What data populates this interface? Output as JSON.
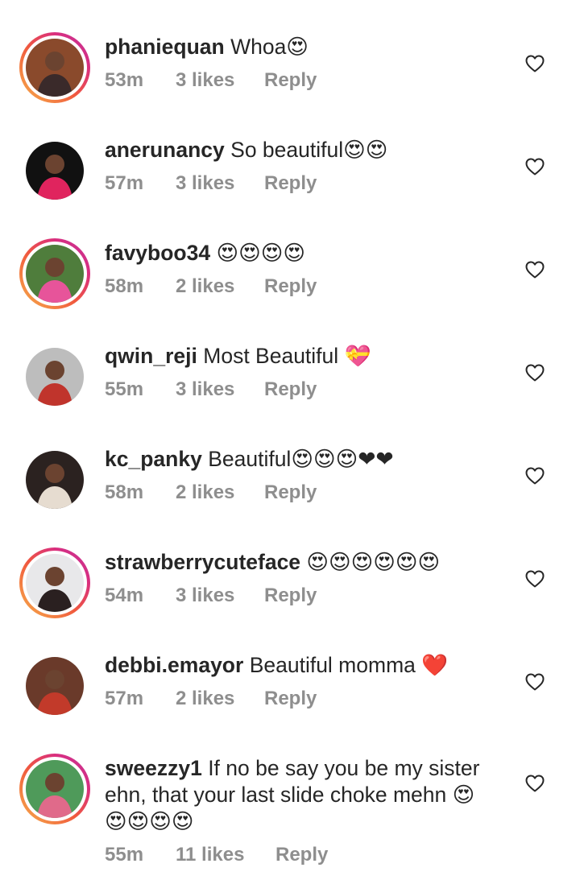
{
  "comments": [
    {
      "username": "phaniequan",
      "text": "Whoa😍",
      "time": "53m",
      "likes": "3 likes",
      "reply": "Reply",
      "story": true,
      "avatar_colors": [
        "#8a4a2c",
        "#3a2a2a"
      ]
    },
    {
      "username": "anerunancy",
      "text": "So beautiful😍😍",
      "time": "57m",
      "likes": "3 likes",
      "reply": "Reply",
      "story": false,
      "avatar_colors": [
        "#111111",
        "#e0245e"
      ]
    },
    {
      "username": "favyboo34",
      "text": "😍😍😍😍",
      "time": "58m",
      "likes": "2 likes",
      "reply": "Reply",
      "story": true,
      "avatar_colors": [
        "#4f7d3c",
        "#e7549a"
      ]
    },
    {
      "username": "qwin_reji",
      "text": "Most Beautiful 💝",
      "time": "55m",
      "likes": "3 likes",
      "reply": "Reply",
      "story": false,
      "avatar_colors": [
        "#bdbdbd",
        "#c0342c"
      ]
    },
    {
      "username": "kc_panky",
      "text": "Beautiful😍😍😍❤❤",
      "time": "58m",
      "likes": "2 likes",
      "reply": "Reply",
      "story": false,
      "avatar_colors": [
        "#2b2220",
        "#e6dcd0"
      ]
    },
    {
      "username": "strawberrycuteface",
      "text": "😍😍😍😍😍😍",
      "time": "54m",
      "likes": "3 likes",
      "reply": "Reply",
      "story": true,
      "avatar_colors": [
        "#e8e8ea",
        "#2a2020"
      ]
    },
    {
      "username": "debbi.emayor",
      "text": "Beautiful momma ❤️",
      "time": "57m",
      "likes": "2 likes",
      "reply": "Reply",
      "story": false,
      "avatar_colors": [
        "#6a3a2a",
        "#c23a2a"
      ]
    },
    {
      "username": "sweezzy1",
      "text": "If no be say you be my sister ehn, that your last slide choke mehn 😍",
      "text2": "😍😍😍😍",
      "time": "55m",
      "likes": "11 likes",
      "reply": "Reply",
      "story": true,
      "avatar_colors": [
        "#4f9a5a",
        "#e06a8a"
      ]
    }
  ]
}
